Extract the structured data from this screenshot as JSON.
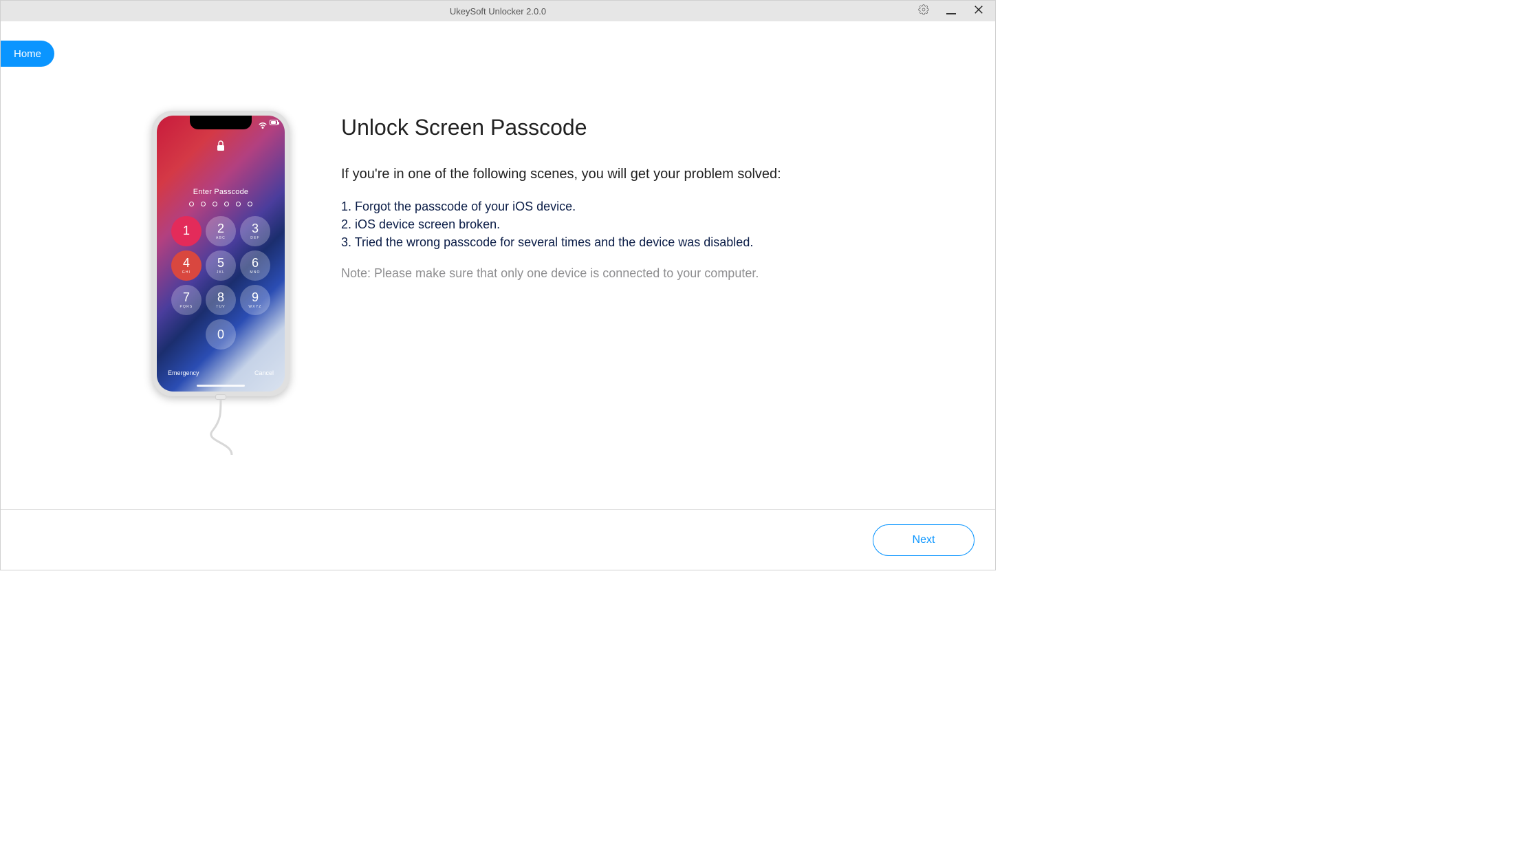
{
  "titlebar": {
    "title": "UkeySoft Unlocker 2.0.0"
  },
  "nav": {
    "home_label": "Home"
  },
  "phone": {
    "prompt": "Enter Passcode",
    "keys": [
      {
        "n": "1",
        "l": ""
      },
      {
        "n": "2",
        "l": "ABC"
      },
      {
        "n": "3",
        "l": "DEF"
      },
      {
        "n": "4",
        "l": "GHI"
      },
      {
        "n": "5",
        "l": "JKL"
      },
      {
        "n": "6",
        "l": "MNO"
      },
      {
        "n": "7",
        "l": "PQRS"
      },
      {
        "n": "8",
        "l": "TUV"
      },
      {
        "n": "9",
        "l": "WXYZ"
      }
    ],
    "zero": "0",
    "emergency": "Emergency",
    "cancel": "Cancel"
  },
  "page": {
    "heading": "Unlock Screen Passcode",
    "intro": "If you're in one of the following scenes, you will get your problem solved:",
    "scenes": [
      "1. Forgot the passcode of your iOS device.",
      "2. iOS device screen broken.",
      "3. Tried the wrong passcode for several times and the device was disabled."
    ],
    "note": "Note: Please make sure that only one device is connected to your computer."
  },
  "footer": {
    "next_label": "Next"
  }
}
